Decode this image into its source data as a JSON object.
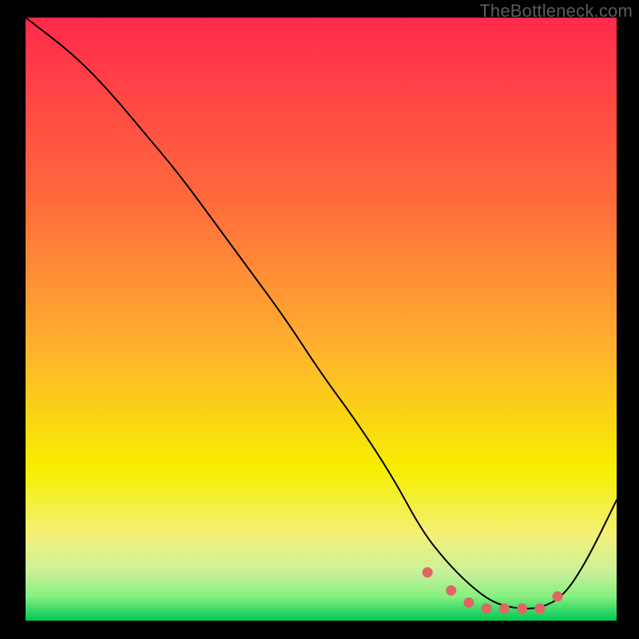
{
  "watermark": "TheBottleneck.com",
  "colors": {
    "bg": "#000000",
    "top": "#ff2a4c",
    "low_yellow": "#f6ef00",
    "green_light": "#86f080",
    "green_dark": "#00c853",
    "curve": "#000000",
    "dots": "#e06666"
  },
  "chart_data": {
    "type": "line",
    "title": "",
    "xlabel": "",
    "ylabel": "",
    "xlim": [
      0,
      100
    ],
    "ylim": [
      0,
      100
    ],
    "series": [
      {
        "name": "curve",
        "x": [
          0,
          8,
          14,
          20,
          26,
          32,
          38,
          44,
          50,
          56,
          62,
          67,
          71,
          75,
          79,
          83,
          87,
          91,
          95,
          100
        ],
        "values": [
          100,
          94,
          88,
          81,
          74,
          66,
          58,
          50,
          41,
          33,
          24,
          15,
          10,
          6,
          3,
          2,
          2,
          4,
          10,
          20
        ]
      },
      {
        "name": "highlight-dots",
        "x": [
          68,
          72,
          75,
          78,
          81,
          84,
          87,
          90
        ],
        "values": [
          8,
          5,
          3,
          2,
          2,
          2,
          2,
          4
        ]
      }
    ]
  }
}
